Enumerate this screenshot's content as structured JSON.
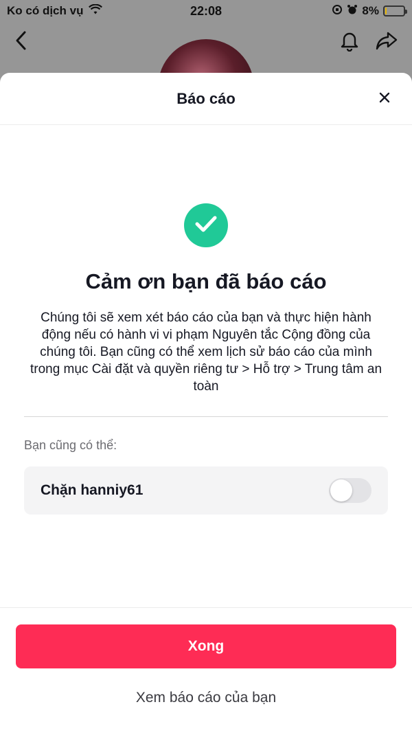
{
  "status_bar": {
    "carrier": "Ko có dịch vụ",
    "time": "22:08",
    "battery": "8%",
    "battery_level": 0.08
  },
  "sheet": {
    "title": "Báo cáo",
    "headline": "Cảm ơn bạn đã báo cáo",
    "description": "Chúng tôi sẽ xem xét báo cáo của bạn và thực hiện hành động nếu có hành vi vi phạm Nguyên tắc Cộng đồng của chúng tôi. Bạn cũng có thể xem lịch sử báo cáo của mình trong mục Cài đặt và quyền riêng tư > Hỗ trợ > Trung tâm an toàn",
    "also_label": "Bạn cũng có thể:",
    "block_label": "Chặn hanniy61",
    "block_enabled": false,
    "done_label": "Xong",
    "view_reports_label": "Xem báo cáo của bạn"
  },
  "colors": {
    "accent": "#fe2c55",
    "success": "#20c997"
  }
}
